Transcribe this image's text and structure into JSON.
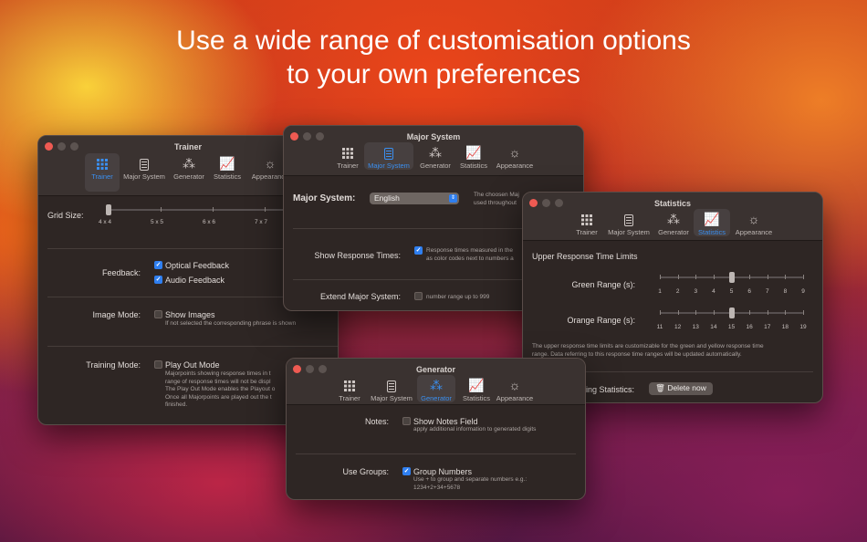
{
  "headline": {
    "line1": "Use a wide range of customisation options",
    "line2": "to your own preferences"
  },
  "tabs": {
    "trainer": "Trainer",
    "major": "Major System",
    "generator": "Generator",
    "statistics": "Statistics",
    "appearance": "Appearance"
  },
  "icons": {
    "trainer": "grid-icon",
    "major": "book-icon",
    "generator": "magic-wand-icon",
    "statistics": "chart-icon",
    "appearance": "sun-icon"
  },
  "accent_color": "#3a8ff0",
  "trainer": {
    "title": "Trainer",
    "grid_size_label": "Grid Size:",
    "grid_ticks": [
      "4 x 4",
      "5 x 5",
      "6 x 6",
      "7 x 7"
    ],
    "grid_selected": "4 x 4",
    "feedback_label": "Feedback:",
    "optical": "Optical Feedback",
    "audio": "Audio Feedback",
    "image_mode_label": "Image Mode:",
    "show_images": "Show Images",
    "show_images_desc": "If not selected the corresponding phrase is shown",
    "training_mode_label": "Training Mode:",
    "play_out": "Play Out Mode",
    "play_out_desc1": "Majorpoints showing response times in t",
    "play_out_desc2": "range of response times will not be displ",
    "play_out_desc3": "The Play Out Mode enables the Playout o",
    "play_out_desc4": "Once all Majorpoints are played out the t",
    "play_out_desc5": "finished."
  },
  "major": {
    "title": "Major System",
    "label": "Major System:",
    "selected": "English",
    "desc1": "The choosen Maj",
    "desc2": "used throughout",
    "response_label": "Show Response Times:",
    "response_desc1": "Response times measured in the",
    "response_desc2": "as color codes next to numbers a",
    "extend_label": "Extend Major System:",
    "extend_desc": "number range up to 999"
  },
  "statistics": {
    "title": "Statistics",
    "section": "Upper Response Time Limits",
    "green_label": "Green Range (s):",
    "green_ticks": [
      "1",
      "2",
      "3",
      "4",
      "5",
      "6",
      "7",
      "8",
      "9"
    ],
    "green_value": 5,
    "orange_label": "Orange Range (s):",
    "orange_ticks": [
      "11",
      "12",
      "13",
      "14",
      "15",
      "16",
      "17",
      "18",
      "19"
    ],
    "orange_value": 15,
    "desc1": "The upper response time limits are customizable for the green and yellow response time",
    "desc2": "range. Data referring to this response time ranges will be updated automatically.",
    "reset_label": "Reset Training Statistics:",
    "delete": "Delete now"
  },
  "generator": {
    "title": "Generator",
    "notes_label": "Notes:",
    "notes_field": "Show Notes Field",
    "notes_desc": "apply additional information to generated digits",
    "groups_label": "Use Groups:",
    "group_numbers": "Group Numbers",
    "groups_desc1": "Use + to group and separate numbers e.g.:",
    "groups_desc2": "1234+2+34+5678"
  }
}
